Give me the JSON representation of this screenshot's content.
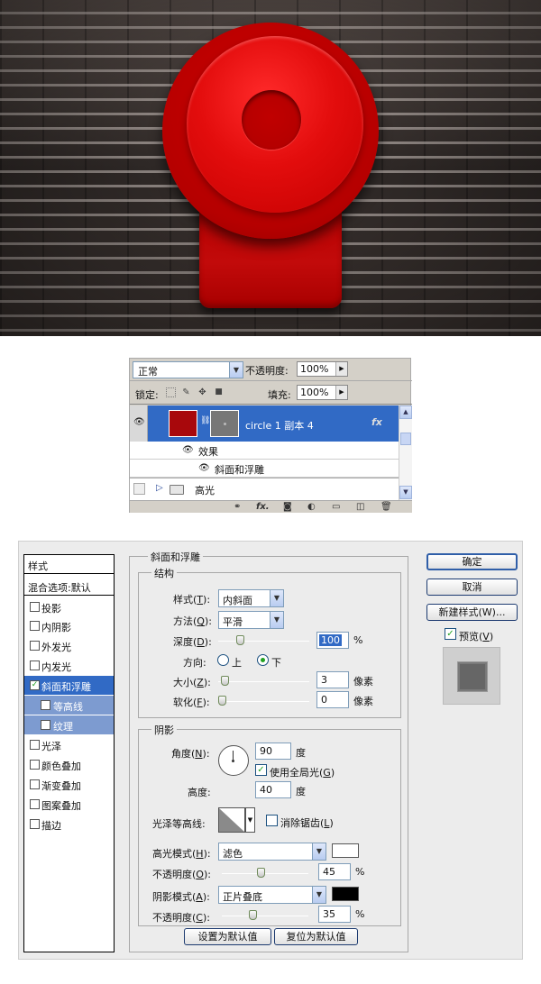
{
  "colors": {
    "bell_red": "#d10000",
    "selection_blue": "#316ac5",
    "layer_thumb": "#a8080c",
    "highlight_color": "#ffffff",
    "shadow_color": "#000000"
  },
  "layers_panel": {
    "blend_mode": "正常",
    "opacity_label": "不透明度:",
    "opacity_value": "100%",
    "lock_label": "锁定:",
    "fill_label": "填充:",
    "fill_value": "100%",
    "layer_name": "circle 1 副本 4",
    "effects_label": "效果",
    "bevel_effect_label": "斜面和浮雕",
    "group_name": "高光",
    "icons": [
      "link-icon",
      "fx-icon",
      "mask-icon",
      "adjustment-icon",
      "folder-icon",
      "new-layer-icon",
      "trash-icon"
    ]
  },
  "dialog": {
    "styles_header": "样式",
    "blend_options": "混合选项:默认",
    "style_items": [
      {
        "label": "投影",
        "checked": false
      },
      {
        "label": "内阴影",
        "checked": false
      },
      {
        "label": "外发光",
        "checked": false
      },
      {
        "label": "内发光",
        "checked": false
      },
      {
        "label": "斜面和浮雕",
        "checked": true,
        "active": true
      },
      {
        "label": "等高线",
        "checked": false,
        "sub": true
      },
      {
        "label": "纹理",
        "checked": false,
        "sub": true
      },
      {
        "label": "光泽",
        "checked": false
      },
      {
        "label": "颜色叠加",
        "checked": false
      },
      {
        "label": "渐变叠加",
        "checked": false
      },
      {
        "label": "图案叠加",
        "checked": false
      },
      {
        "label": "描边",
        "checked": false
      }
    ],
    "bevel_title": "斜面和浮雕",
    "structure": {
      "title": "结构",
      "style_label": "样式(",
      "style_key": "T",
      "style_value": "内斜面",
      "technique_label": "方法(",
      "technique_key": "Q",
      "technique_value": "平滑",
      "depth_label": "深度(",
      "depth_key": "D",
      "depth_value": "100",
      "depth_percent": 1.0,
      "percent": "%",
      "direction_label": "方向:",
      "direction_up": "上",
      "direction_down": "下",
      "direction_selected": "下",
      "size_label": "大小(",
      "size_key": "Z",
      "size_value": "3",
      "size_fraction": 0.03,
      "soften_label": "软化(",
      "soften_key": "F",
      "soften_value": "0",
      "soften_fraction": 0.0,
      "pixels": "像素"
    },
    "shading": {
      "title": "阴影",
      "angle_label": "角度(",
      "angle_key": "N",
      "angle_value": "90",
      "degree": "度",
      "global_light_label": "使用全局光(",
      "global_light_key": "G",
      "global_light_checked": true,
      "altitude_label": "高度:",
      "altitude_value": "40",
      "gloss_contour_label": "光泽等高线:",
      "anti_aliased_label": "消除锯齿(",
      "anti_aliased_key": "L",
      "anti_aliased_checked": false,
      "highlight_mode_label": "高光模式(",
      "highlight_mode_key": "H",
      "highlight_mode_value": "滤色",
      "highlight_opacity_label": "不透明度(",
      "highlight_opacity_key": "O",
      "highlight_opacity_value": "45",
      "highlight_opacity_fraction": 0.45,
      "shadow_mode_label": "阴影模式(",
      "shadow_mode_key": "A",
      "shadow_mode_value": "正片叠底",
      "shadow_opacity_label": "不透明度(",
      "shadow_opacity_key": "C",
      "shadow_opacity_value": "35",
      "shadow_opacity_fraction": 0.35
    },
    "make_default": "设置为默认值",
    "reset_default": "复位为默认值",
    "ok": "确定",
    "cancel": "取消",
    "new_style": "新建样式(W)...",
    "preview_label": "预览(",
    "preview_key": "V",
    "preview_checked": true
  }
}
